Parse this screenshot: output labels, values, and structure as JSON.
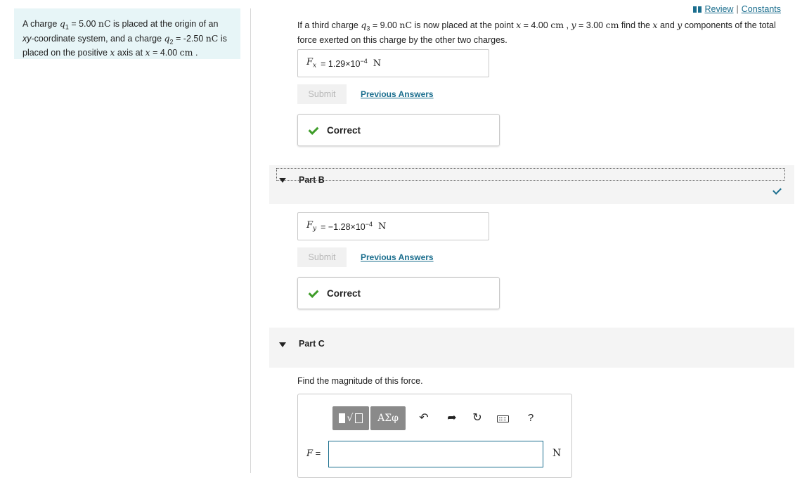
{
  "top_links": {
    "review": "Review",
    "separator": "|",
    "constants": "Constants"
  },
  "problem": {
    "p1": "A charge ",
    "q1_sym": "q",
    "q1_sub": "1",
    "p2": " = 5.00 ",
    "unit_nc": "nC",
    "p3": " is placed at the origin of an ",
    "xy": "xy",
    "p4": "-coordinate system, and a charge ",
    "q2_sym": "q",
    "q2_sub": "2",
    "p5": " = -2.50 ",
    "p6": " is placed on the positive ",
    "xvar": "x",
    "p7": " axis at ",
    "p8": " = 4.00 ",
    "unit_cm": "cm",
    "p9": " ."
  },
  "question": {
    "t1": "If a third charge ",
    "q3_sym": "q",
    "q3_sub": "3",
    "t2": " = 9.00 ",
    "unit_nc": "nC",
    "t3": " is now placed at the point ",
    "x": "x",
    "t4": " = 4.00 ",
    "unit_cm": "cm",
    "t5": " , ",
    "y": "y",
    "t6": " = 3.00 ",
    "t7": " find the ",
    "t8": " and ",
    "t9": " components of the total force exerted on this charge by the other two charges."
  },
  "part_a": {
    "var": "F",
    "sub": "x",
    "eq": " = ",
    "mantissa": "1.29×10",
    "exponent": "−4",
    "unit": "N",
    "submit": "Submit",
    "previous": "Previous Answers",
    "status": "Correct"
  },
  "part_b": {
    "title": "Part B",
    "var": "F",
    "sub": "y",
    "eq": " = ",
    "mantissa": "−1.28×10",
    "exponent": "−4",
    "unit": "N",
    "submit": "Submit",
    "previous": "Previous Answers",
    "status": "Correct"
  },
  "part_c": {
    "title": "Part C",
    "prompt": "Find the magnitude of this force.",
    "greek_btn": "ΑΣφ",
    "help": "?",
    "f_label": "F",
    "f_eq": " =",
    "unit": "N",
    "input_value": ""
  },
  "colors": {
    "accent": "#1b6e8e",
    "success": "#3f9d2a",
    "panel_bg": "#e7f5f7"
  }
}
